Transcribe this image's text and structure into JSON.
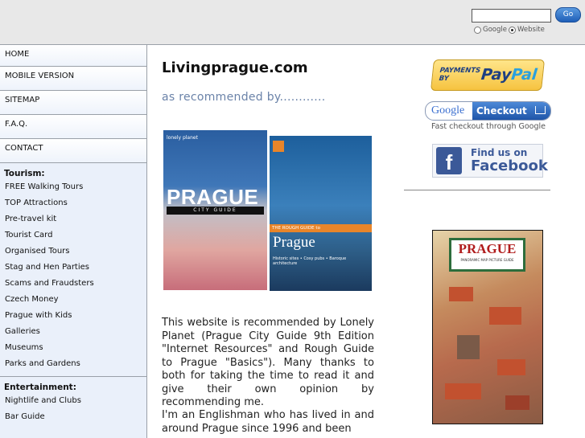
{
  "header": {
    "search_placeholder": "",
    "go_label": "Go",
    "radio_options": [
      {
        "label": "Google",
        "selected": false
      },
      {
        "label": "Website",
        "selected": true
      }
    ]
  },
  "sidebar": {
    "main_items": [
      {
        "label": "HOME"
      },
      {
        "label": "MOBILE VERSION"
      },
      {
        "label": "SITEMAP"
      },
      {
        "label": "F.A.Q."
      },
      {
        "label": "CONTACT"
      }
    ],
    "tourism": {
      "heading": "Tourism:",
      "items": [
        "FREE Walking Tours",
        "TOP Attractions",
        "Pre-travel kit",
        "Tourist Card",
        "Organised Tours",
        "Stag and Hen Parties",
        "Scams and Fraudsters",
        "Czech Money",
        "Prague with Kids",
        "Galleries",
        "Museums",
        "Parks and Gardens"
      ]
    },
    "entertainment": {
      "heading": "Entertainment:",
      "items": [
        "Nightlife and Clubs",
        "Bar Guide"
      ]
    }
  },
  "main": {
    "title": "Livingprague.com",
    "recommended": "as recommended by............",
    "book1": {
      "brand": "lonely planet",
      "title": "PRAGUE",
      "subtitle": "CITY GUIDE"
    },
    "book2": {
      "title": "Prague",
      "bar": "THE ROUGH GUIDE to",
      "tagline": "Historic sites • Cosy pubs • Baroque architecture"
    },
    "paragraph1": "This website is recommended by Lonely Planet (Prague City Guide 9th Edition \"Internet Resources\" and Rough Guide to Prague \"Basics\"). Many thanks to both for taking the time to read it and give their own opinion by recommending me.",
    "paragraph2": "I'm an Englishman who has lived in and around Prague since 1996 and been"
  },
  "right": {
    "paypal": {
      "small": "PAYMENTS BY",
      "brand_a": "Pay",
      "brand_b": "Pal"
    },
    "google_checkout": {
      "google": "Google",
      "checkout": "Checkout",
      "caption": "Fast checkout through Google"
    },
    "facebook": {
      "find": "Find us on",
      "name": "Facebook"
    },
    "map": {
      "title": "PRAGUE",
      "subtitle": "PANORAMIC MAP PICTURE GUIDE"
    }
  },
  "colors": {
    "accent": "#6b83a9",
    "sidebar_bg": "#eaf0fa",
    "facebook": "#3b5998"
  }
}
